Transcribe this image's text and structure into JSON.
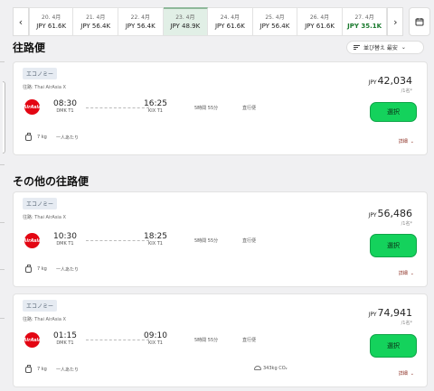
{
  "date_strip": {
    "prev_icon": "chevron-left-icon",
    "next_icon": "chevron-right-icon",
    "calendar_icon": "calendar-icon",
    "dates": [
      {
        "label": "20. 4月",
        "price": "JPY 61.6K",
        "selected": false,
        "cheapest": false
      },
      {
        "label": "21. 4月",
        "price": "JPY 56.4K",
        "selected": false,
        "cheapest": false
      },
      {
        "label": "22. 4月",
        "price": "JPY 56.4K",
        "selected": false,
        "cheapest": false
      },
      {
        "label": "23. 4月",
        "price": "JPY 48.9K",
        "selected": true,
        "cheapest": false
      },
      {
        "label": "24. 4月",
        "price": "JPY 61.6K",
        "selected": false,
        "cheapest": false
      },
      {
        "label": "25. 4月",
        "price": "JPY 56.4K",
        "selected": false,
        "cheapest": false
      },
      {
        "label": "26. 4月",
        "price": "JPY 61.6K",
        "selected": false,
        "cheapest": false
      },
      {
        "label": "27. 4月",
        "price": "JPY 35.1K",
        "selected": false,
        "cheapest": true
      }
    ]
  },
  "sections": {
    "outbound_title": "往路便",
    "other_title": "その他の往路便",
    "sort_label": "並び替え  最安",
    "sort_chevron": "⌄"
  },
  "flights": [
    {
      "badge": "エコノミー",
      "airline": "往路: Thai AirAsia X",
      "logo_text": "AirAsia",
      "depart_time": "08:30",
      "depart_airport": "DMK T1",
      "arrive_time": "16:25",
      "arrive_airport": "KIX T1",
      "duration": "5時間 55分",
      "stops": "直行便",
      "currency": "JPY",
      "price": "42,034",
      "per_person": "/1名*",
      "select_label": "選択",
      "baggage": "7 kg",
      "per_each": "一人あたり",
      "details": "詳細",
      "co2": ""
    },
    {
      "badge": "エコノミー",
      "airline": "往路: Thai AirAsia X",
      "logo_text": "AirAsia",
      "depart_time": "10:30",
      "depart_airport": "DMK T1",
      "arrive_time": "18:25",
      "arrive_airport": "KIX T1",
      "duration": "5時間 55分",
      "stops": "直行便",
      "currency": "JPY",
      "price": "56,486",
      "per_person": "/1名*",
      "select_label": "選択",
      "baggage": "7 kg",
      "per_each": "一人あたり",
      "details": "詳細",
      "co2": ""
    },
    {
      "badge": "エコノミー",
      "airline": "往路: Thai AirAsia X",
      "logo_text": "AirAsia",
      "depart_time": "01:15",
      "depart_airport": "DMK T1",
      "arrive_time": "09:10",
      "arrive_airport": "KIX T1",
      "duration": "5時間 55分",
      "stops": "直行便",
      "currency": "JPY",
      "price": "74,941",
      "per_person": "/1名*",
      "select_label": "選択",
      "baggage": "7 kg",
      "per_each": "一人あたり",
      "details": "詳細",
      "co2": "343kg CO₂"
    }
  ],
  "colors": {
    "select_green": "#14d25c",
    "cheapest_green": "#1a7a2e",
    "selected_date_bg": "#e1efe6",
    "details_red": "#8a2a1e",
    "airasia_red": "#e30613"
  }
}
